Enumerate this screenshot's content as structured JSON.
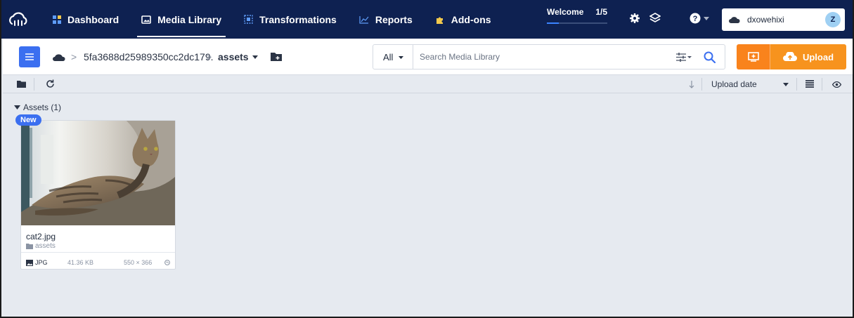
{
  "nav": {
    "items": [
      {
        "label": "Dashboard",
        "icon": "dashboard-icon",
        "active": false
      },
      {
        "label": "Media Library",
        "icon": "media-library-icon",
        "active": true
      },
      {
        "label": "Transformations",
        "icon": "transformations-icon",
        "active": false
      },
      {
        "label": "Reports",
        "icon": "reports-icon",
        "active": false
      },
      {
        "label": "Add-ons",
        "icon": "puzzle-icon",
        "active": false
      }
    ],
    "welcome_label": "Welcome",
    "welcome_progress": "1/5",
    "welcome_fraction": 0.2,
    "account_name": "dxowehixi",
    "avatar_initial": "Z"
  },
  "toolbar": {
    "breadcrumb_cloud": "5fa3688d25989350cc2dc179.",
    "breadcrumb_folder": "assets",
    "search_scope": "All",
    "search_placeholder": "Search Media Library",
    "upload_label": "Upload"
  },
  "secbar": {
    "sort_label": "Upload date"
  },
  "content": {
    "section_title": "Assets (1)",
    "assets": [
      {
        "badge": "New",
        "file_name": "cat2.jpg",
        "folder": "assets",
        "format": "JPG",
        "size": "41.36 KB",
        "dimensions": "550 × 366"
      }
    ]
  },
  "colors": {
    "nav_bg": "#0e2151",
    "accent_blue": "#3b6ff0",
    "upload_orange": "#f7931e",
    "content_bg": "#e6eaf0"
  }
}
